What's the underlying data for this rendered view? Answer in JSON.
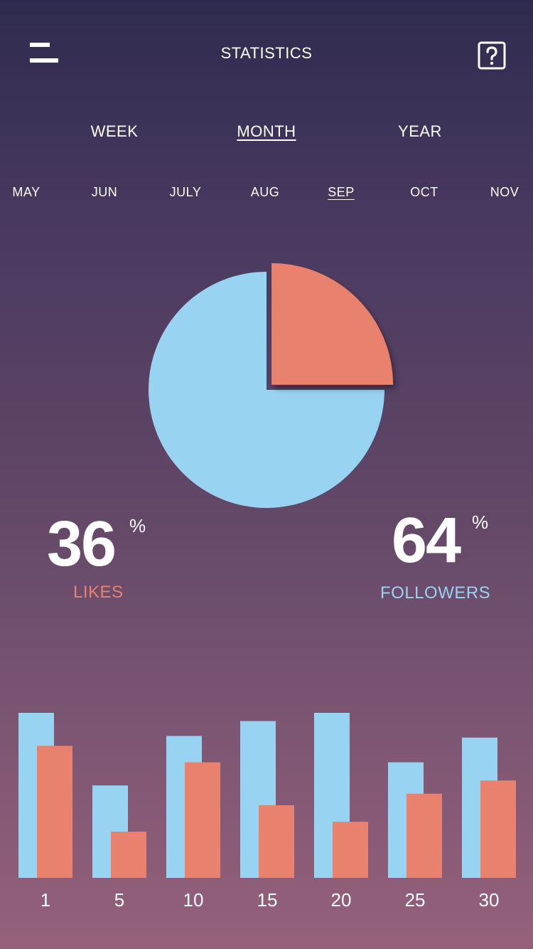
{
  "header": {
    "title": "STATISTICS",
    "menu_icon": "hamburger-menu-icon",
    "help_icon": "question-mark-icon"
  },
  "period_tabs": [
    {
      "label": "WEEK",
      "active": false
    },
    {
      "label": "MONTH",
      "active": true
    },
    {
      "label": "YEAR",
      "active": false
    }
  ],
  "month_tabs": [
    {
      "label": "MAY",
      "active": false
    },
    {
      "label": "JUN",
      "active": false
    },
    {
      "label": "JULY",
      "active": false
    },
    {
      "label": "AUG",
      "active": false
    },
    {
      "label": "SEP",
      "active": true
    },
    {
      "label": "OCT",
      "active": false
    },
    {
      "label": "NOV",
      "active": false
    }
  ],
  "stats": {
    "likes": {
      "value": "36",
      "unit": "%",
      "label": "LIKES"
    },
    "followers": {
      "value": "64",
      "unit": "%",
      "label": "FOLLOWERS"
    }
  },
  "colors": {
    "likes": "#e8826e",
    "followers": "#98d3f1",
    "background_top": "#2f2b4f",
    "background_bottom": "#96607a"
  },
  "chart_data": [
    {
      "type": "pie",
      "slices": [
        {
          "name": "LIKES",
          "value": 25
        },
        {
          "name": "FOLLOWERS",
          "value": 75
        }
      ]
    },
    {
      "type": "bar",
      "categories": [
        "1",
        "5",
        "10",
        "15",
        "20",
        "25",
        "30"
      ],
      "series": [
        {
          "name": "FOLLOWERS",
          "values": [
            100,
            56,
            86,
            95,
            100,
            70,
            85
          ]
        },
        {
          "name": "LIKES",
          "values": [
            80,
            28,
            70,
            44,
            34,
            51,
            59
          ]
        }
      ],
      "ylim": [
        0,
        100
      ]
    }
  ]
}
